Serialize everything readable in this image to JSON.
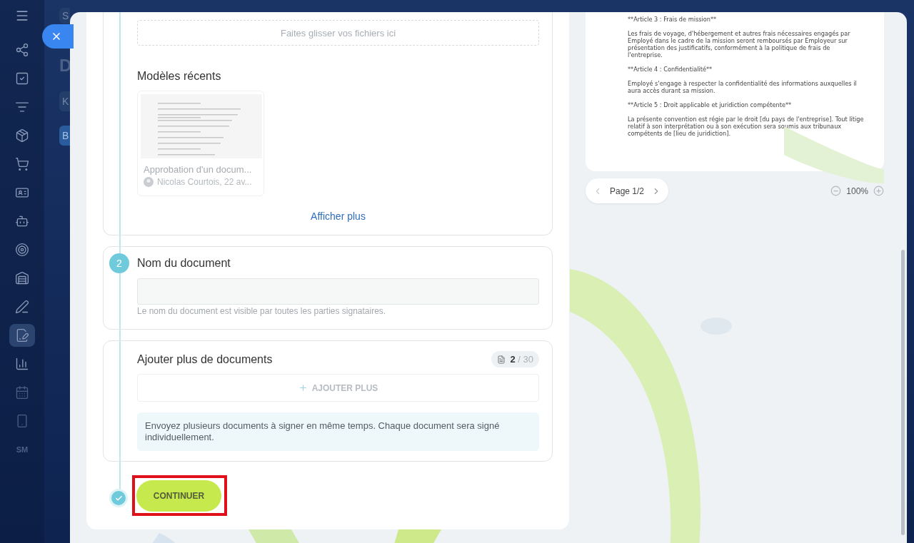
{
  "sidebar": {
    "items": [
      {
        "kind": "nodes",
        "selected": false
      },
      {
        "kind": "tasks",
        "selected": false
      },
      {
        "kind": "funnel",
        "selected": false
      },
      {
        "kind": "box",
        "selected": false
      },
      {
        "kind": "cart",
        "selected": false
      },
      {
        "kind": "card",
        "selected": false
      },
      {
        "kind": "robot",
        "selected": false
      },
      {
        "kind": "target",
        "selected": false
      },
      {
        "kind": "warehouse",
        "selected": false
      },
      {
        "kind": "pen",
        "selected": false
      },
      {
        "kind": "sign",
        "selected": true
      },
      {
        "kind": "chart",
        "selected": false
      },
      {
        "kind": "calendar",
        "selected": false
      },
      {
        "kind": "phone",
        "selected": false
      },
      {
        "kind": "text",
        "label": "SM",
        "selected": false
      }
    ]
  },
  "background_page": {
    "search_letter": "S",
    "title_letter": "D",
    "button_letter": "K",
    "tab_letter": "B"
  },
  "form": {
    "upload": {
      "dropzone": "Faites glisser vos fichiers ici",
      "recent_title": "Modèles récents",
      "templates": [
        {
          "name": "Approbation d'un docum...",
          "author": "Nicolas Courtois, 22 av..."
        }
      ],
      "show_more": "Afficher plus"
    },
    "name_step": {
      "number": "2",
      "title": "Nom du document",
      "hint": "Le nom du document est visible par toutes les parties signataires."
    },
    "more_docs": {
      "title": "Ajouter plus de documents",
      "count": "2",
      "limit": "/ 30",
      "add_button": "AJOUTER PLUS",
      "info": "Envoyez plusieurs documents à signer en même temps. Chaque document sera signé individuellement."
    },
    "continue_button": "CONTINUER"
  },
  "preview": {
    "paragraphs": [
      "**Article 3 : Frais de mission**",
      "Les frais de voyage, d'hébergement et autres frais nécessaires engagés par Employé dans le cadre de la mission seront remboursés par Employeur sur présentation des justificatifs, conformément à la politique de frais de l'entreprise.",
      "**Article 4 : Confidentialité**",
      "Employé s'engage à respecter la confidentialité des informations auxquelles il aura accès durant sa mission.",
      "**Article 5 : Droit applicable et juridiction compétente**",
      "La présente convention est régie par le droit [du pays de l'entreprise]. Tout litige relatif à son interprétation ou à son exécution sera soumis aux tribunaux compétents de [lieu de juridiction]."
    ],
    "page": "Page 1/2",
    "zoom": "100%"
  }
}
